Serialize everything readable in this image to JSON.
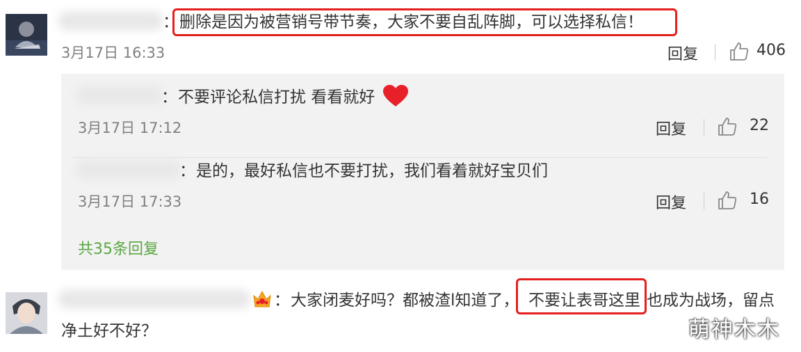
{
  "comments": [
    {
      "text": "删除是因为被营销号带节奏，大家不要自乱阵脚，可以选择私信！",
      "date": "3月17日 16:33",
      "reply_label": "回复",
      "likes": "406"
    },
    {
      "text_start": "大家闭麦好吗？都被渣l知道了，",
      "text_highlight": "不要让表哥这里",
      "text_end": "也成为战场，留点",
      "text_line2": "净土好不好？"
    }
  ],
  "replies": [
    {
      "text": "不要评论私信打扰 看看就好",
      "date": "3月17日 17:12",
      "reply_label": "回复",
      "likes": "22"
    },
    {
      "text": "是的，最好私信也不要打扰，我们看着就好宝贝们",
      "date": "3月17日 17:33",
      "reply_label": "回复",
      "likes": "16"
    }
  ],
  "colon": "：",
  "more_replies": "共35条回复",
  "watermark": "萌神木木",
  "colors": {
    "highlight_box": "#e41e1e",
    "more_link": "#5aa642",
    "panel_bg": "#f2f2f2"
  }
}
